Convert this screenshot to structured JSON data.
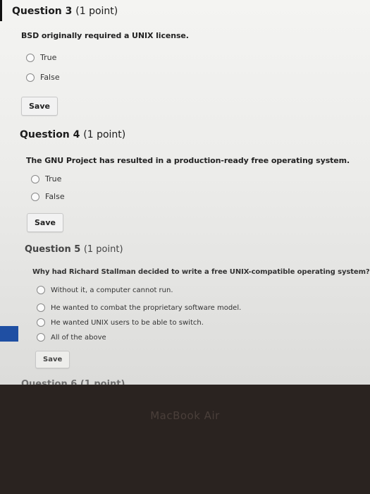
{
  "q3": {
    "title": "Question 3",
    "points": "(1 point)",
    "text": "BSD originally required a UNIX license.",
    "options": [
      "True",
      "False"
    ],
    "save": "Save"
  },
  "q4": {
    "title": "Question 4",
    "points": "(1 point)",
    "text": "The GNU Project has resulted in a production-ready free operating system.",
    "options": [
      "True",
      "False"
    ],
    "save": "Save"
  },
  "q5": {
    "title": "Question 5",
    "points": "(1 point)",
    "text": "Why had Richard Stallman decided to write a free UNIX-compatible operating system?",
    "options": [
      "Without it, a computer cannot run.",
      "He wanted to combat the proprietary software model.",
      "He wanted UNIX users to be able to switch.",
      "All of the above"
    ],
    "save": "Save"
  },
  "next": {
    "title": "Question 6 (1 point)"
  },
  "device": {
    "brand": "MacBook Air"
  }
}
